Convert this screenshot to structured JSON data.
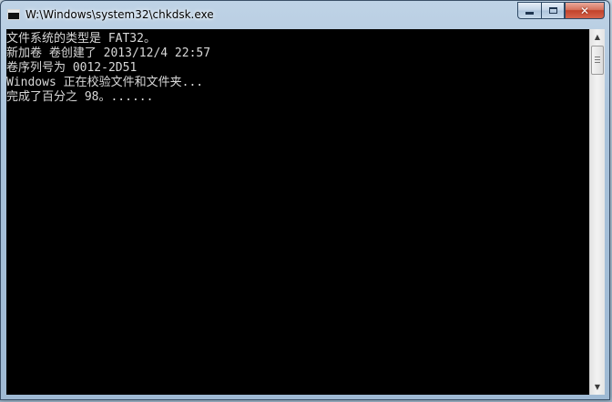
{
  "window": {
    "title": "W:\\Windows\\system32\\chkdsk.exe",
    "close_label": "✕"
  },
  "console": {
    "lines": [
      "文件系统的类型是 FAT32。",
      "新加卷 卷创建了 2013/12/4 22:57",
      "卷序列号为 0012-2D51",
      "Windows 正在校验文件和文件夹...",
      "完成了百分之 98。......"
    ],
    "text_color": "#d8d8d8",
    "background_color": "#000000"
  },
  "icons": {
    "app": "console-app-icon",
    "minimize": "minimize-icon",
    "maximize": "maximize-icon",
    "close": "close-icon",
    "scroll_up": "chevron-up-icon",
    "scroll_down": "chevron-down-icon"
  }
}
